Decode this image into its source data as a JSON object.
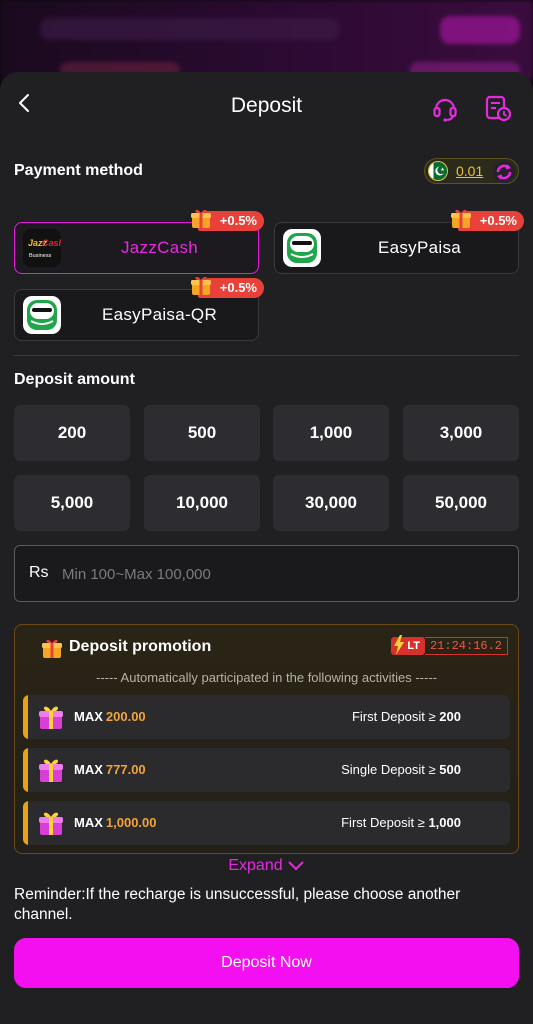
{
  "header": {
    "title": "Deposit"
  },
  "payment": {
    "label": "Payment method",
    "balance": "0.01",
    "methods": [
      {
        "name": "JazzCash",
        "bonus": "+0.5%",
        "selected": true
      },
      {
        "name": "EasyPaisa",
        "bonus": "+0.5%",
        "selected": false
      },
      {
        "name": "EasyPaisa-QR",
        "bonus": "+0.5%",
        "selected": false
      }
    ]
  },
  "amount": {
    "label": "Deposit amount",
    "options": [
      "200",
      "500",
      "1,000",
      "3,000",
      "5,000",
      "10,000",
      "30,000",
      "50,000"
    ],
    "currency": "Rs",
    "placeholder": "Min 100~Max 100,000"
  },
  "promotion": {
    "title": "Deposit promotion",
    "lt": "LT",
    "timer": "21:24:16.2",
    "subtitle": "----- Automatically participated in the following activities -----",
    "rows": [
      {
        "max_label": "MAX",
        "amount": "200.00",
        "condition": "First Deposit ≥",
        "condition_value": "200"
      },
      {
        "max_label": "MAX",
        "amount": "777.00",
        "condition": "Single Deposit ≥",
        "condition_value": "500"
      },
      {
        "max_label": "MAX",
        "amount": "1,000.00",
        "condition": "First Deposit ≥",
        "condition_value": "1,000"
      }
    ],
    "expand_label": "Expand"
  },
  "reminder": "Reminder:If the recharge is unsuccessful, please choose another channel.",
  "deposit_button": "Deposit Now",
  "colors": {
    "accent": "#f30ff0",
    "badge": "#e8413a",
    "promo_amount": "#f2a43a",
    "balance": "#e8c23a"
  },
  "icons": [
    "back-icon",
    "headset-icon",
    "history-icon",
    "pakistan-flag-icon",
    "refresh-icon",
    "gift-icon",
    "bolt-icon",
    "chevron-down-icon"
  ]
}
